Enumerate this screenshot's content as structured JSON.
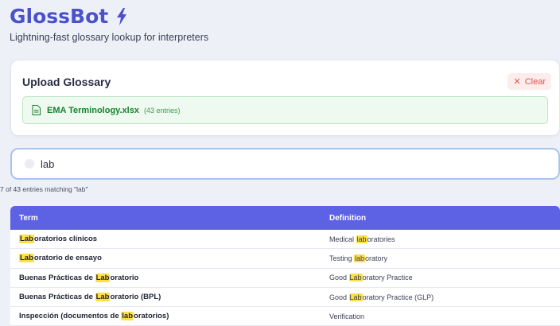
{
  "header": {
    "title": "GlossBot",
    "subtitle": "Lightning-fast glossary lookup for interpreters",
    "icon": "lightning-bolt-icon"
  },
  "upload": {
    "title": "Upload Glossary",
    "clear_label": "Clear",
    "file_name": "EMA Terminology.xlsx",
    "file_count": "(43 entries)"
  },
  "search": {
    "value": "lab",
    "match_text": "7 of 43 entries matching \"lab\""
  },
  "table": {
    "headers": {
      "term": "Term",
      "definition": "Definition"
    },
    "rows": [
      {
        "term": [
          "",
          "Lab",
          "oratorios clínicos"
        ],
        "definition": [
          "Medical ",
          "lab",
          "oratories"
        ]
      },
      {
        "term": [
          "",
          "Lab",
          "oratorio de ensayo"
        ],
        "definition": [
          "Testing ",
          "lab",
          "oratory"
        ]
      },
      {
        "term": [
          "Buenas Prácticas de ",
          "Lab",
          "oratorio"
        ],
        "definition": [
          "Good ",
          "Lab",
          "oratory Practice"
        ]
      },
      {
        "term": [
          "Buenas Prácticas de ",
          "Lab",
          "oratorio (BPL)"
        ],
        "definition": [
          "Good ",
          "Lab",
          "oratory Practice (GLP)"
        ]
      },
      {
        "term": [
          "Inspección (documentos de ",
          "lab",
          "oratorios)"
        ],
        "definition": [
          "Verification",
          "",
          ""
        ]
      }
    ]
  },
  "colors": {
    "accent": "#4a51c9",
    "table_header": "#5d61e3",
    "highlight": "#fde047",
    "success": "#17822f",
    "danger": "#e0534f"
  }
}
